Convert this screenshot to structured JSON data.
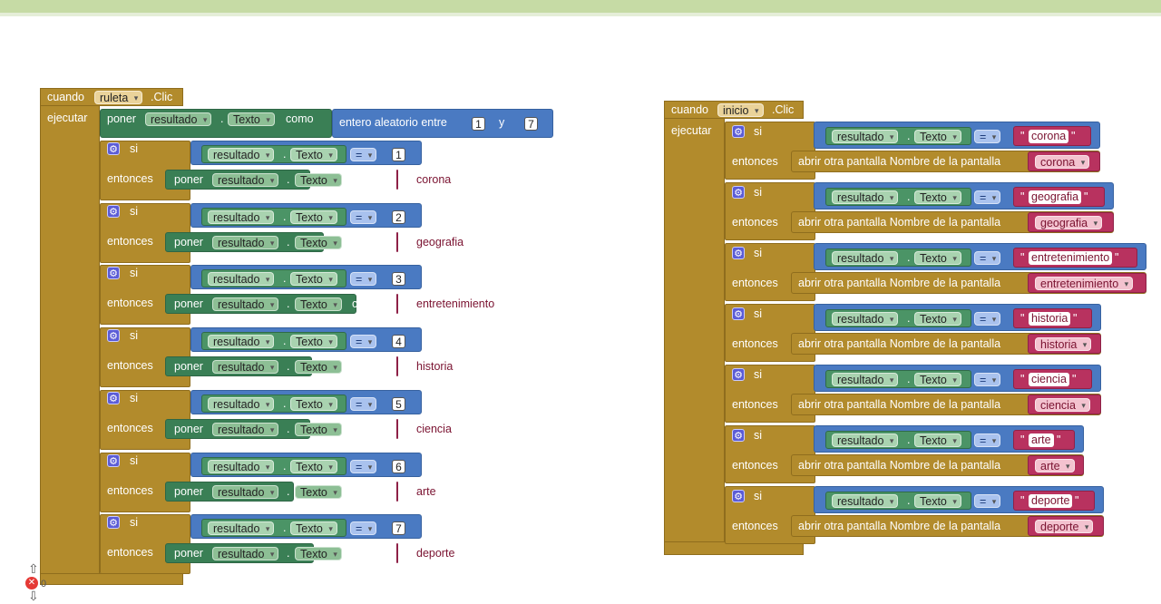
{
  "left_block": {
    "event": {
      "when": "cuando",
      "component": "ruleta",
      "event": ".Clic",
      "do": "ejecutar"
    },
    "first": {
      "set": "poner",
      "component": "resultado",
      "property": "Texto",
      "as": "como",
      "random_label": "entero aleatorio entre",
      "from": "1",
      "and": "y",
      "to": "7"
    },
    "rows": [
      {
        "if": "si",
        "then": "entonces",
        "component": "resultado",
        "property": "Texto",
        "op": "=",
        "num": "1",
        "set": "poner",
        "as": "como",
        "value": "corona"
      },
      {
        "if": "si",
        "then": "entonces",
        "component": "resultado",
        "property": "Texto",
        "op": "=",
        "num": "2",
        "set": "poner",
        "as": "como",
        "value": "geografia"
      },
      {
        "if": "si",
        "then": "entonces",
        "component": "resultado",
        "property": "Texto",
        "op": "=",
        "num": "3",
        "set": "poner",
        "as": "como",
        "value": "entretenimiento"
      },
      {
        "if": "si",
        "then": "entonces",
        "component": "resultado",
        "property": "Texto",
        "op": "=",
        "num": "4",
        "set": "poner",
        "as": "como",
        "value": "historia"
      },
      {
        "if": "si",
        "then": "entonces",
        "component": "resultado",
        "property": "Texto",
        "op": "=",
        "num": "5",
        "set": "poner",
        "as": "como",
        "value": "ciencia"
      },
      {
        "if": "si",
        "then": "entonces",
        "component": "resultado",
        "property": "Texto",
        "op": "=",
        "num": "6",
        "set": "poner",
        "as": "como",
        "value": "arte"
      },
      {
        "if": "si",
        "then": "entonces",
        "component": "resultado",
        "property": "Texto",
        "op": "=",
        "num": "7",
        "set": "poner",
        "as": "como",
        "value": "deporte"
      }
    ]
  },
  "right_block": {
    "event": {
      "when": "cuando",
      "component": "inicio",
      "event": ".Clic",
      "do": "ejecutar"
    },
    "rows": [
      {
        "if": "si",
        "then": "entonces",
        "component": "resultado",
        "property": "Texto",
        "op": "=",
        "text": "corona",
        "action": "abrir otra pantalla  Nombre de la pantalla",
        "screen": "corona"
      },
      {
        "if": "si",
        "then": "entonces",
        "component": "resultado",
        "property": "Texto",
        "op": "=",
        "text": "geografia",
        "action": "abrir otra pantalla  Nombre de la pantalla",
        "screen": "geografia"
      },
      {
        "if": "si",
        "then": "entonces",
        "component": "resultado",
        "property": "Texto",
        "op": "=",
        "text": "entretenimiento",
        "action": "abrir otra pantalla  Nombre de la pantalla",
        "screen": "entretenimiento"
      },
      {
        "if": "si",
        "then": "entonces",
        "component": "resultado",
        "property": "Texto",
        "op": "=",
        "text": "historia",
        "action": "abrir otra pantalla  Nombre de la pantalla",
        "screen": "historia"
      },
      {
        "if": "si",
        "then": "entonces",
        "component": "resultado",
        "property": "Texto",
        "op": "=",
        "text": "ciencia",
        "action": "abrir otra pantalla  Nombre de la pantalla",
        "screen": "ciencia"
      },
      {
        "if": "si",
        "then": "entonces",
        "component": "resultado",
        "property": "Texto",
        "op": "=",
        "text": "arte",
        "action": "abrir otra pantalla  Nombre de la pantalla",
        "screen": "arte"
      },
      {
        "if": "si",
        "then": "entonces",
        "component": "resultado",
        "property": "Texto",
        "op": "=",
        "text": "deporte",
        "action": "abrir otra pantalla  Nombre de la pantalla",
        "screen": "deporte"
      }
    ]
  },
  "warnings": {
    "count": "0",
    "icons": [
      "up-arrow-icon",
      "error-icon",
      "down-arrow-icon"
    ]
  },
  "colors": {
    "event": "#b28b2c",
    "control": "#4a7ac2",
    "setter": "#3a7f55",
    "text": "#b8325f",
    "topbar": "#c6dba5"
  }
}
